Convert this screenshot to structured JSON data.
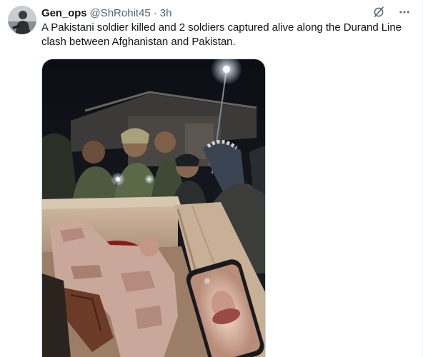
{
  "tweet": {
    "display_name": "Gen_ops",
    "handle": "@ShRohit45",
    "separator": "·",
    "time": "3h",
    "text": "A Pakistani soldier killed and 2 soldiers captured alive along the Durand Line clash between Afghanistan and Pakistan.",
    "media": {
      "description_icon": "photo-image"
    }
  },
  "icons": {
    "grok": "grok-icon",
    "more": "more-icon"
  },
  "colors": {
    "text_primary": "#0f1419",
    "text_secondary": "#536471",
    "border": "#cfd9de"
  }
}
